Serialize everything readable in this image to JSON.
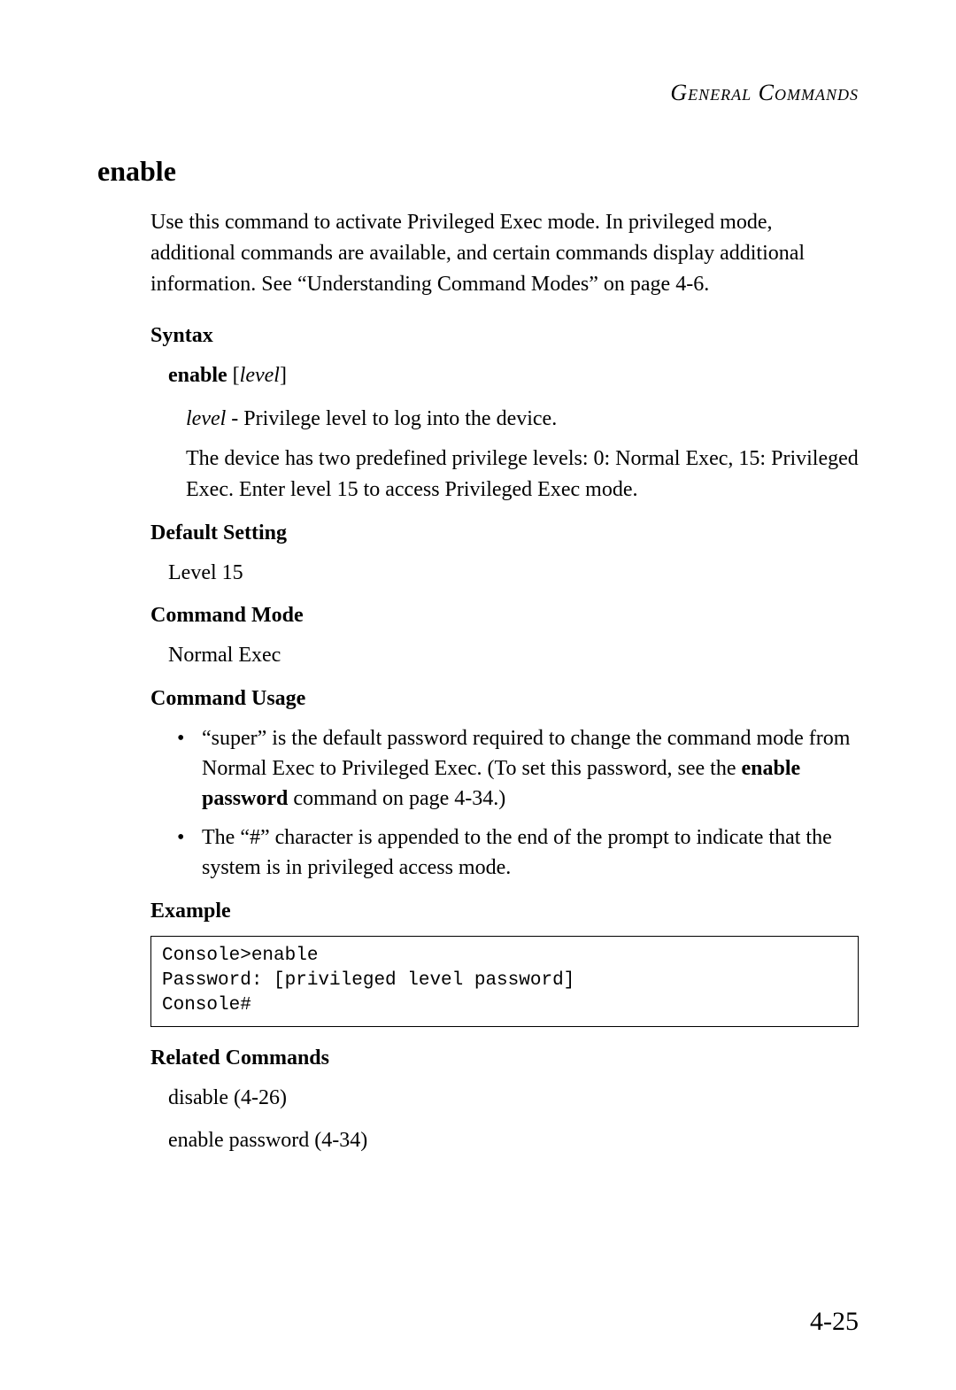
{
  "header": {
    "title": "General Commands"
  },
  "command": {
    "name": "enable",
    "intro": "Use this command to activate Privileged Exec mode. In privileged mode, additional commands are available, and certain commands display additional information. See “Understanding Command Modes” on page 4-6."
  },
  "syntax": {
    "heading": "Syntax",
    "cmd_bold": "enable",
    "bracket_open": " [",
    "cmd_italic": "level",
    "bracket_close": "]",
    "param_name": "level",
    "param_sep": " - ",
    "param_desc": "Privilege level to log into the device.",
    "param_detail": "The device has two predefined privilege levels: 0: Normal Exec, 15: Privileged Exec. Enter level 15 to access Privileged Exec mode."
  },
  "default_setting": {
    "heading": "Default Setting",
    "value": "Level 15"
  },
  "command_mode": {
    "heading": "Command Mode",
    "value": "Normal Exec"
  },
  "command_usage": {
    "heading": "Command Usage",
    "bullets": [
      {
        "pre": "“super” is the default password required to change the command mode from Normal Exec to Privileged Exec. (To set this password, see the ",
        "bold": "enable password",
        "post": " command on page 4-34.)"
      },
      {
        "pre": "The “#” character is appended to the end of the prompt to indicate that the system is in privileged access mode.",
        "bold": "",
        "post": ""
      }
    ]
  },
  "example": {
    "heading": "Example",
    "code": "Console>enable\nPassword: [privileged level password]\nConsole#"
  },
  "related": {
    "heading": "Related Commands",
    "items": [
      "disable (4-26)",
      "enable password (4-34)"
    ]
  },
  "page_number": "4-25"
}
